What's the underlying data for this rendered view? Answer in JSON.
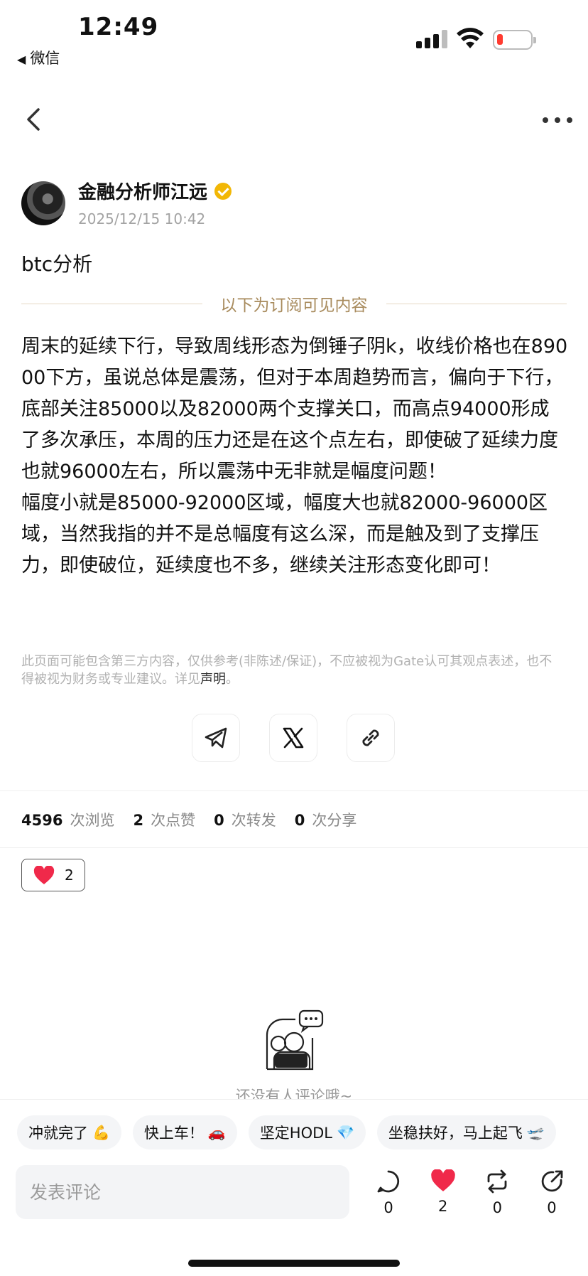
{
  "status_bar": {
    "time": "12:49",
    "back_app": "微信"
  },
  "author": {
    "name": "金融分析师江远",
    "time": "2025/12/15 10:42"
  },
  "post": {
    "title": "btc分析",
    "subscription_divider": "以下为订阅可见内容",
    "content": "周末的延续下行，导致周线形态为倒锤子阴k，收线价格也在89000下方，虽说总体是震荡，但对于本周趋势而言，偏向于下行，底部关注85000以及82000两个支撑关口，而高点94000形成了多次承压，本周的压力还是在这个点左右，即使破了延续力度也就96000左右，所以震荡中无非就是幅度问题！\n幅度小就是85000-92000区域，幅度大也就82000-96000区域，当然我指的并不是总幅度有这么深，而是触及到了支撑压力，即使破位，延续度也不多，继续关注形态变化即可！",
    "disclaimer": "此页面可能包含第三方内容，仅供参考(非陈述/保证)，不应被视为Gate认可其观点表述，也不得被视为财务或专业建议。详见",
    "disclaimer_link": "声明",
    "disclaimer_end": "。"
  },
  "share_buttons": [
    "telegram-icon",
    "x-icon",
    "link-icon"
  ],
  "stats": {
    "views": "4596",
    "views_unit": "次浏览",
    "likes": "2",
    "likes_unit": "次点赞",
    "reposts": "0",
    "reposts_unit": "次转发",
    "shares": "0",
    "shares_unit": "次分享"
  },
  "reaction": {
    "icon": "heart-icon",
    "count": "2"
  },
  "empty_comments": "还没有人评论哦~",
  "quick_replies": [
    {
      "text": "冲就完了",
      "emoji": "💪"
    },
    {
      "text": "快上车！",
      "emoji": "🚗"
    },
    {
      "text": "坚定HODL",
      "emoji": "💎"
    },
    {
      "text": "坐稳扶好，马上起飞",
      "emoji": "🛫"
    }
  ],
  "comment_box": {
    "placeholder": "发表评论"
  },
  "actions": {
    "comment_count": "0",
    "like_count": "2",
    "repost_count": "0",
    "share_count": "0"
  },
  "colors": {
    "accent_gold": "#a88b5d",
    "like_red": "#f0294a",
    "verified": "#f2b705"
  }
}
